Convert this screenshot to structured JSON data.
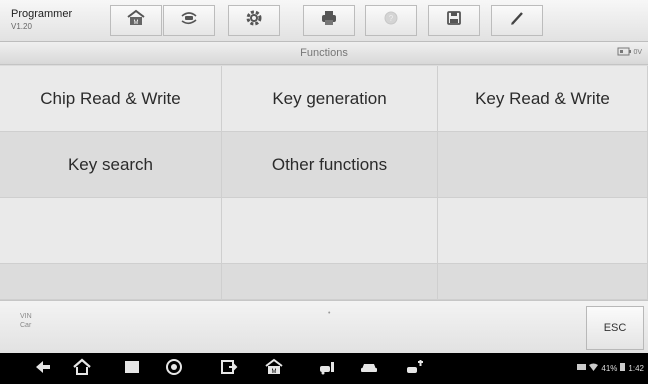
{
  "toolbar": {
    "app_name": "Programmer",
    "app_version": "V1.20",
    "buttons": [
      {
        "name": "home",
        "icon": "home-icon"
      },
      {
        "name": "vehicle-swap",
        "icon": "vehicle-swap-icon"
      },
      {
        "name": "settings",
        "icon": "gear-icon"
      },
      {
        "name": "print",
        "icon": "printer-icon"
      },
      {
        "name": "help",
        "icon": "help-icon"
      },
      {
        "name": "save",
        "icon": "save-icon"
      },
      {
        "name": "data-logging",
        "icon": "pen-icon"
      }
    ]
  },
  "header": {
    "title": "Functions",
    "battery_voltage": "0V"
  },
  "functions": [
    "Chip Read & Write",
    "Key generation",
    "Key Read & Write",
    "Key search",
    "Other functions",
    "",
    "",
    "",
    "",
    "",
    "",
    ""
  ],
  "info_bar": {
    "vin_label": "VIN",
    "car_label": "Car",
    "marker": "•",
    "esc_label": "ESC"
  },
  "navbar": {
    "buttons": [
      "back-icon",
      "home-icon",
      "recent-apps-icon",
      "browser-icon",
      "screenshot-icon",
      "maxisys-home-icon",
      "vehicle-menu-icon",
      "car-icon",
      "vci-connection-icon"
    ],
    "status": {
      "battery_percent": "41%",
      "time": "1:42"
    }
  },
  "colors": {
    "toolbar_bg": "#e9e9e9",
    "grid_light": "#eaeaea",
    "grid_dark": "#dcdcdc",
    "text": "#2b2b2b",
    "navbar_bg": "#000000"
  }
}
